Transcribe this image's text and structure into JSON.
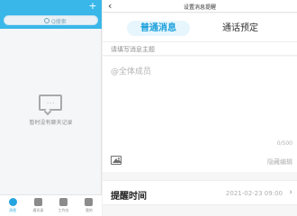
{
  "left_panel": {
    "header_plus": "+",
    "search": {
      "placeholder": "Q搜索"
    },
    "empty": {
      "text": "暂时没有聊天记录"
    },
    "tabs": [
      {
        "label": "消息",
        "icon": "chat-icon",
        "active": true
      },
      {
        "label": "通讯录",
        "icon": "contacts-icon",
        "active": false
      },
      {
        "label": "工作台",
        "icon": "workbench-icon",
        "active": false
      },
      {
        "label": "我的",
        "icon": "profile-icon",
        "active": false
      }
    ]
  },
  "right_panel": {
    "title": "设置消息提醒",
    "back": "‹",
    "segments": [
      {
        "label": "普通消息",
        "active": true
      },
      {
        "label": "通话预定",
        "active": false
      }
    ],
    "subject_placeholder": "请填写消息主题",
    "members_placeholder": "@全体成员",
    "count": "0/500",
    "collapse": "隐藏编辑",
    "reminder": {
      "label": "提醒时间",
      "value": "2021-02-23 09:00"
    },
    "chevron": "›"
  },
  "colors": {
    "brand": "#39b7e8",
    "active_tab": "#25a5df",
    "segment_active_bg": "#e7f6fd",
    "segment_active_text": "#1aa0dc"
  }
}
